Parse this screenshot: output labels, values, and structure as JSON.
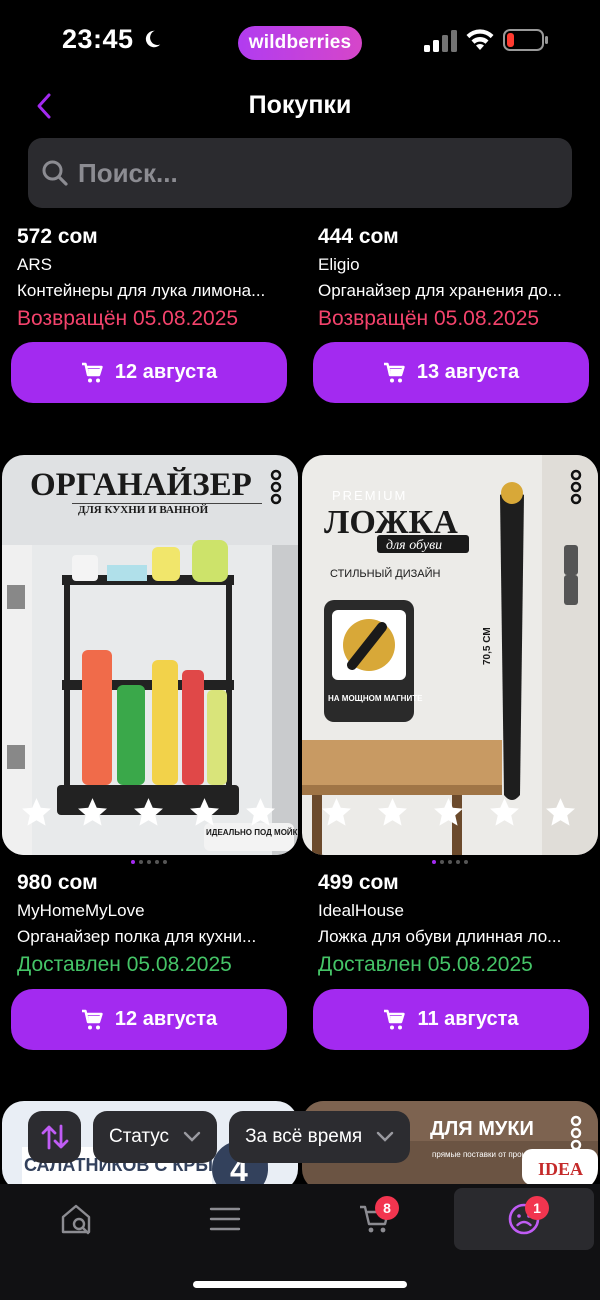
{
  "status_bar": {
    "time": "23:45",
    "brand": "wildberries",
    "icons": [
      "moon-icon",
      "signal-icon",
      "wifi-icon",
      "battery-icon"
    ]
  },
  "header": {
    "title": "Покупки",
    "back_icon": "chevron-left-icon"
  },
  "search": {
    "placeholder": "Поиск..."
  },
  "products": [
    {
      "price": "572 сом",
      "seller": "ARS",
      "name": "Контейнеры для лука лимона...",
      "status": "Возвращён 05.08.2025",
      "status_kind": "returned",
      "cart_label": "12 августа"
    },
    {
      "price": "444 сом",
      "seller": "Eligio",
      "name": "Органайзер для хранения до...",
      "status": "Возвращён 05.08.2025",
      "status_kind": "returned",
      "cart_label": "13 августа"
    },
    {
      "image": {
        "headline": "ОРГАНАЙЗЕР",
        "subline": "ДЛЯ КУХНИ И ВАННОЙ",
        "sticker": "ИДЕАЛЬНО ПОД МОЙКУ!"
      },
      "rating_stars": 5,
      "price": "980 сом",
      "seller": "MyHomeMyLove",
      "name": "Органайзер полка для кухни...",
      "status": "Доставлен 05.08.2025",
      "status_kind": "delivered",
      "cart_label": "12 августа"
    },
    {
      "image": {
        "premium": "PREMIUM",
        "headline": "ЛОЖКА",
        "subline": "для обуви",
        "feature": "СТИЛЬНЫЙ ДИЗАЙН",
        "magnet": "НА МОЩНОМ МАГНИТЕ",
        "size": "70,5 СМ"
      },
      "rating_stars": 5,
      "price": "499 сом",
      "seller": "IdealHouse",
      "name": "Ложка для обуви длинная ло...",
      "status": "Доставлен 05.08.2025",
      "status_kind": "delivered",
      "cart_label": "11 августа"
    },
    {
      "image": {
        "headline": "САЛАТНИКОВ С КРЫШКОЙ",
        "count": "4"
      }
    },
    {
      "image": {
        "headline": "ДЛЯ МУКИ",
        "subline": "прямые поставки от производителя",
        "logo": "IDEA"
      }
    }
  ],
  "filters": {
    "sort_icon": "sort-arrows-icon",
    "status_label": "Статус",
    "period_label": "За всё время"
  },
  "tab_bar": {
    "items": [
      {
        "icon": "home-search-icon"
      },
      {
        "icon": "menu-icon"
      },
      {
        "icon": "cart-icon",
        "badge": "8"
      },
      {
        "icon": "profile-icon",
        "badge": "1",
        "active": true
      }
    ]
  },
  "colors": {
    "accent": "#a32af0",
    "returned": "#f4436c",
    "delivered": "#45c467",
    "badge": "#f2354f"
  }
}
